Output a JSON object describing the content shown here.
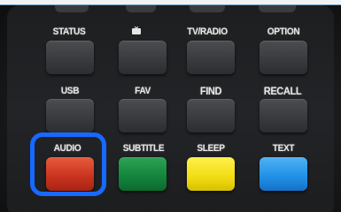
{
  "remote": {
    "row1": {
      "status": "STATUS",
      "tv_radio": "TV/RADIO",
      "option": "OPTION"
    },
    "row2": {
      "usb": "USB",
      "fav": "FAV",
      "find": "FIND",
      "recall": "RECALL"
    },
    "row3": {
      "audio": "AUDIO",
      "subtitle": "SUBTITLE",
      "sleep": "SLEEP",
      "text": "TEXT"
    }
  },
  "colors": {
    "highlight": "#1769ff",
    "red": "#c8321e",
    "green": "#13833b",
    "yellow": "#f1dc12",
    "blue": "#1e8fe6"
  },
  "icons": {
    "row1_second": "tv-icon"
  }
}
